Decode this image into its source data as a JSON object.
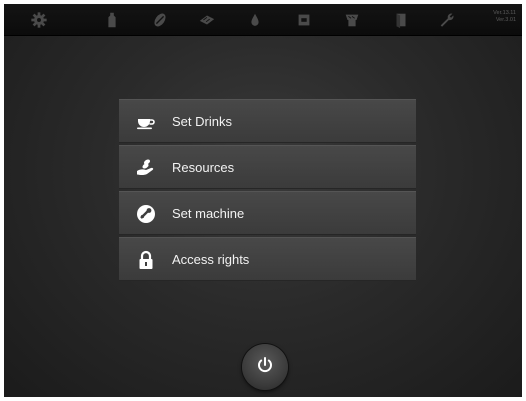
{
  "topbar": {
    "icons": [
      "settings-gear-icon",
      "bottle-icon",
      "descale-icon",
      "cleaning-tablet-icon",
      "water-drop-icon",
      "coffee-machine-icon",
      "grinder-icon",
      "door-icon",
      "wrench-icon"
    ],
    "version_line1": "Ver.13.11",
    "version_line2": "Ver.3.01"
  },
  "menu": {
    "items": [
      {
        "label": "Set Drinks",
        "icon": "cup-icon"
      },
      {
        "label": "Resources",
        "icon": "hand-bean-icon"
      },
      {
        "label": "Set machine",
        "icon": "machine-settings-icon"
      },
      {
        "label": "Access rights",
        "icon": "padlock-icon"
      }
    ]
  },
  "power_button": {
    "icon": "power-icon"
  },
  "colors": {
    "background": "#2a2a2a",
    "topbar": "#0f0f0f",
    "menu_item": "#424242",
    "text": "#f2f2f2",
    "icon": "#4a4a4a"
  }
}
